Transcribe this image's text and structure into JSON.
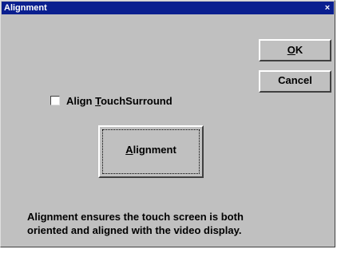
{
  "window": {
    "title": "Alignment",
    "close_glyph": "×"
  },
  "buttons": {
    "ok": {
      "prefix": "",
      "accel": "O",
      "rest": "K"
    },
    "cancel": {
      "label": "Cancel"
    },
    "alignment": {
      "prefix": "",
      "accel": "A",
      "rest": "lignment"
    }
  },
  "checkbox": {
    "checked": false,
    "label_prefix": "Align ",
    "label_accel": "T",
    "label_rest": "ouchSurround"
  },
  "description": {
    "line1": "Alignment ensures the touch screen is both",
    "line2": "oriented and aligned with the video display."
  },
  "icons": {
    "close": "close-icon"
  },
  "colors": {
    "title_bar": "#0a1f8f",
    "dialog_face": "#c0c0c0"
  }
}
